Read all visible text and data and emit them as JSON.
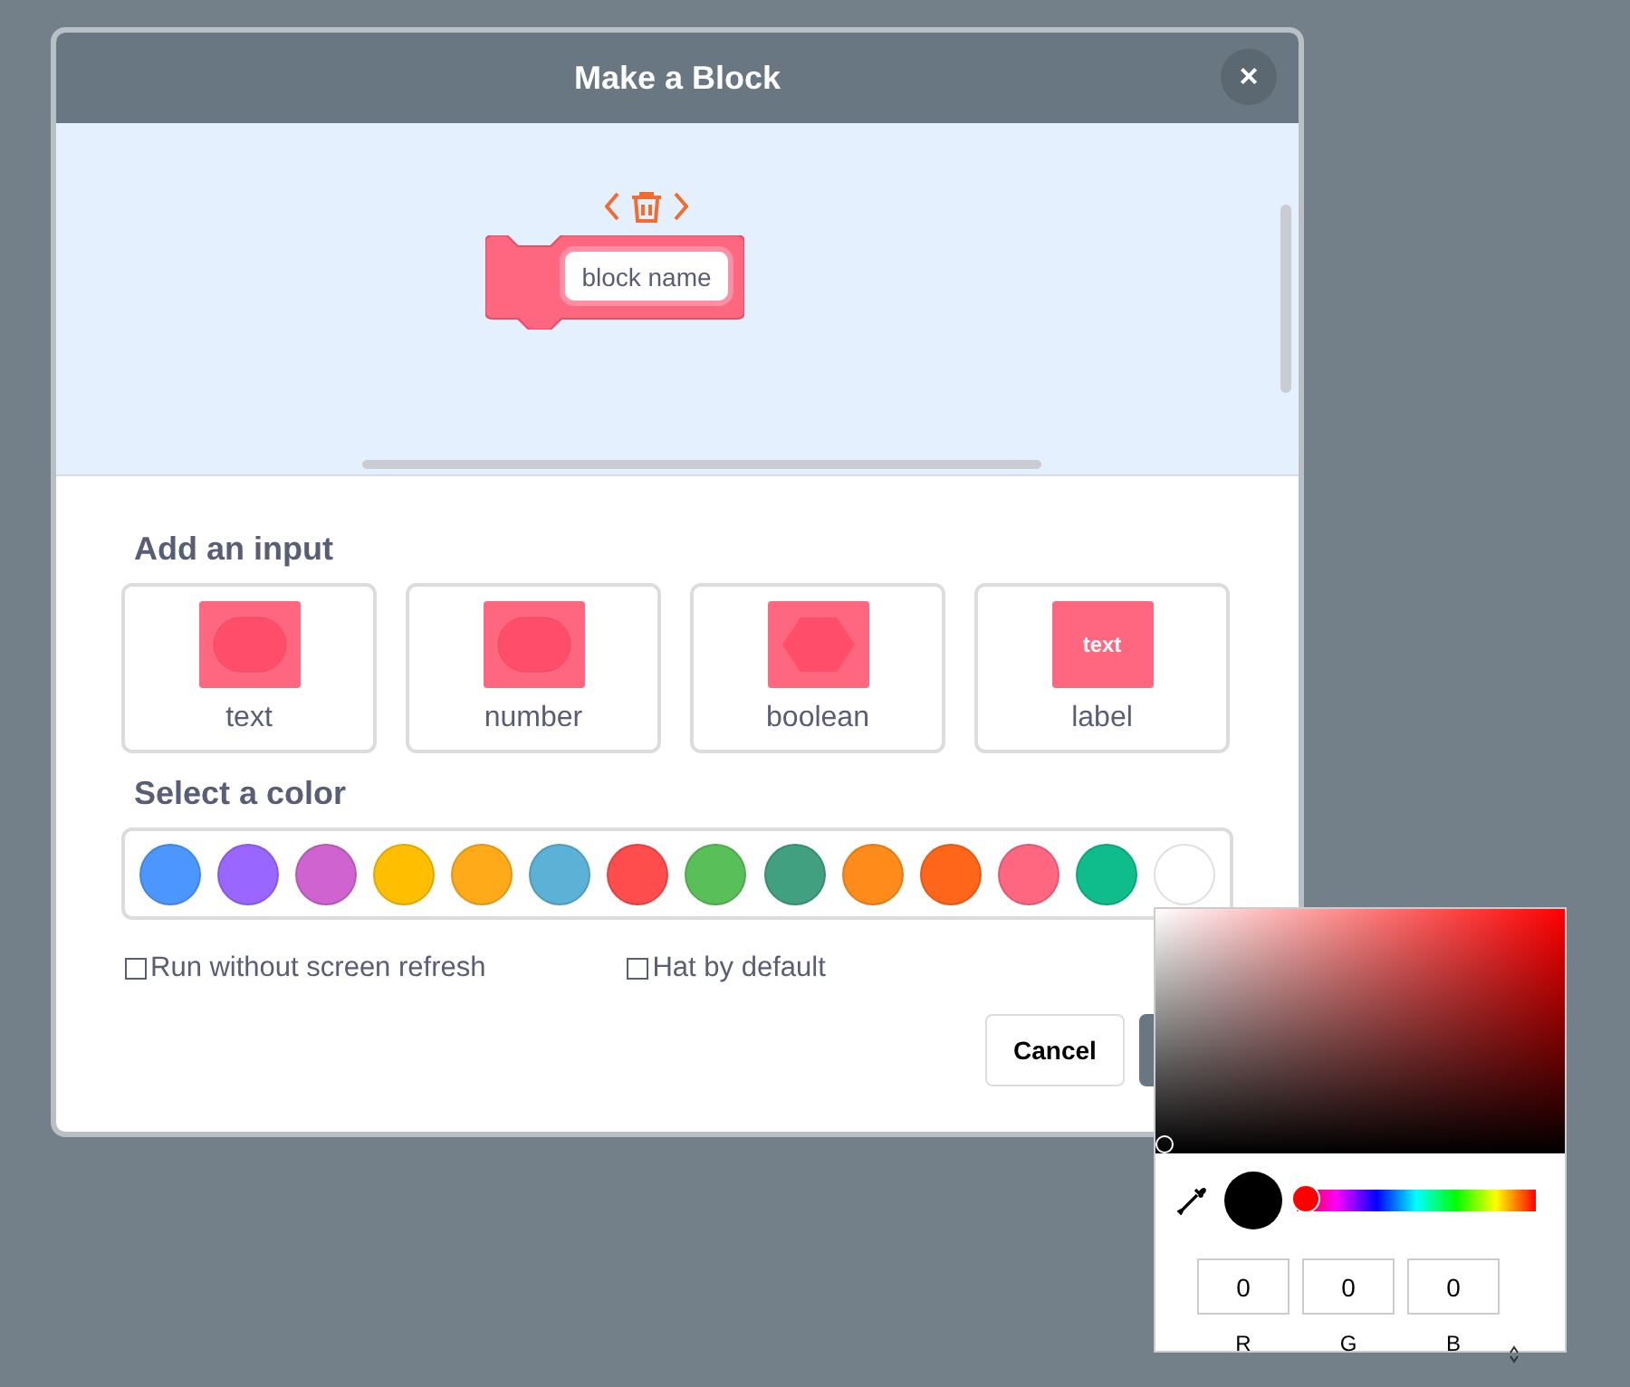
{
  "dialog": {
    "title": "Make a Block",
    "close_label": "×"
  },
  "preview": {
    "block_name": "block name"
  },
  "add_input": {
    "heading": "Add an input",
    "types": [
      {
        "kind": "text",
        "label": "text"
      },
      {
        "kind": "number",
        "label": "number"
      },
      {
        "kind": "boolean",
        "label": "boolean"
      },
      {
        "kind": "label",
        "label": "label",
        "icon_text": "text"
      }
    ]
  },
  "select_color": {
    "heading": "Select a color",
    "colors": [
      {
        "color": "#4c97ff"
      },
      {
        "color": "#9966ff"
      },
      {
        "color": "#cf63cf"
      },
      {
        "color": "#ffbf00"
      },
      {
        "color": "#ffab19"
      },
      {
        "color": "#5cb1d6"
      },
      {
        "color": "#ff4c4c"
      },
      {
        "color": "#59c059"
      },
      {
        "color": "#40a080"
      },
      {
        "color": "#ff8c1a"
      },
      {
        "color": "#ff661a"
      },
      {
        "color": "#ff6680"
      },
      {
        "color": "#0fbd8c"
      },
      {
        "color": "#ffffff"
      }
    ]
  },
  "options": [
    {
      "label": "Run without screen refresh",
      "checked": false
    },
    {
      "label": "Hat by default",
      "checked": false
    }
  ],
  "buttons": {
    "cancel": "Cancel"
  },
  "color_picker": {
    "hue": {
      "level": 0
    },
    "channels": [
      {
        "value": "0",
        "label": "R"
      },
      {
        "value": "0",
        "label": "G"
      },
      {
        "value": "0",
        "label": "B"
      }
    ]
  }
}
